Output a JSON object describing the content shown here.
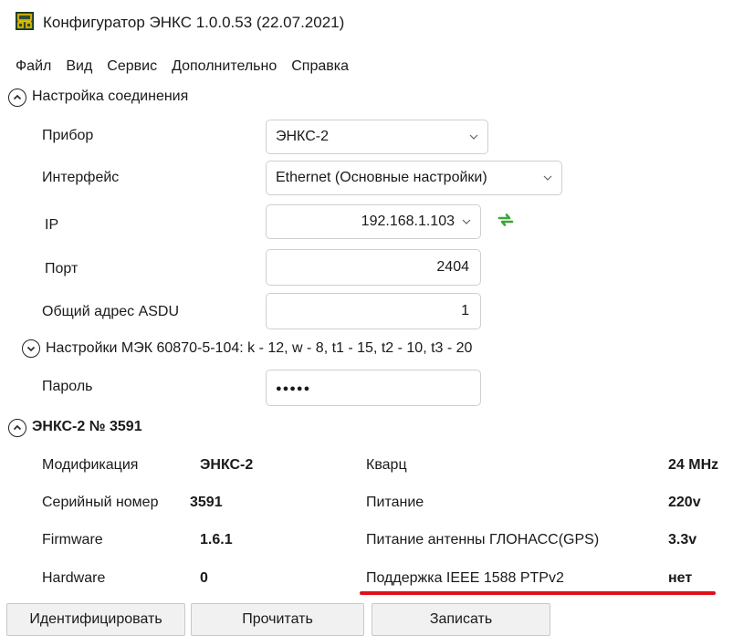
{
  "window": {
    "title": "Конфигуратор ЭНКС 1.0.0.53 (22.07.2021)",
    "app_icon": "ethernet-switch-icon",
    "icon_color": "#2f4f2f",
    "icon_accent": "#f0c000"
  },
  "menu": [
    "Файл",
    "Вид",
    "Сервис",
    "Дополнительно",
    "Справка"
  ],
  "connection": {
    "title": "Настройка соединения",
    "device_label": "Прибор",
    "device_value": "ЭНКС-2",
    "interface_label": "Интерфейс",
    "interface_value": "Ethernet (Основные настройки)",
    "ip_label": "IP",
    "ip_value": "192.168.1.103",
    "refresh_icon": "refresh-arrows-icon",
    "refresh_color": "#3aa63a",
    "port_label": "Порт",
    "port_value": "2404",
    "asdu_label": "Общий адрес ASDU",
    "asdu_value": "1",
    "iec_title": "Настройки МЭК 60870-5-104: k - 12, w - 8, t1 - 15, t2 - 10, t3 - 20",
    "password_label": "Пароль",
    "password_value": "●●●●●"
  },
  "device": {
    "title": "ЭНКС-2 № 3591",
    "left": [
      {
        "label": "Модификация",
        "value": "ЭНКС-2"
      },
      {
        "label": "Серийный номер",
        "value": "3591"
      },
      {
        "label": "Firmware",
        "value": "1.6.1"
      },
      {
        "label": "Hardware",
        "value": "0"
      }
    ],
    "right": [
      {
        "label": "Кварц",
        "value": "24 MHz"
      },
      {
        "label": "Питание",
        "value": "220v"
      },
      {
        "label": "Питание антенны ГЛОНАСС(GPS)",
        "value": "3.3v"
      },
      {
        "label": "Поддержка IEEE 1588 PTPv2",
        "value": "нет"
      }
    ],
    "highlight_color": "#e0101a"
  },
  "buttons": {
    "identify": "Идентифицировать",
    "read": "Прочитать",
    "write": "Записать"
  }
}
